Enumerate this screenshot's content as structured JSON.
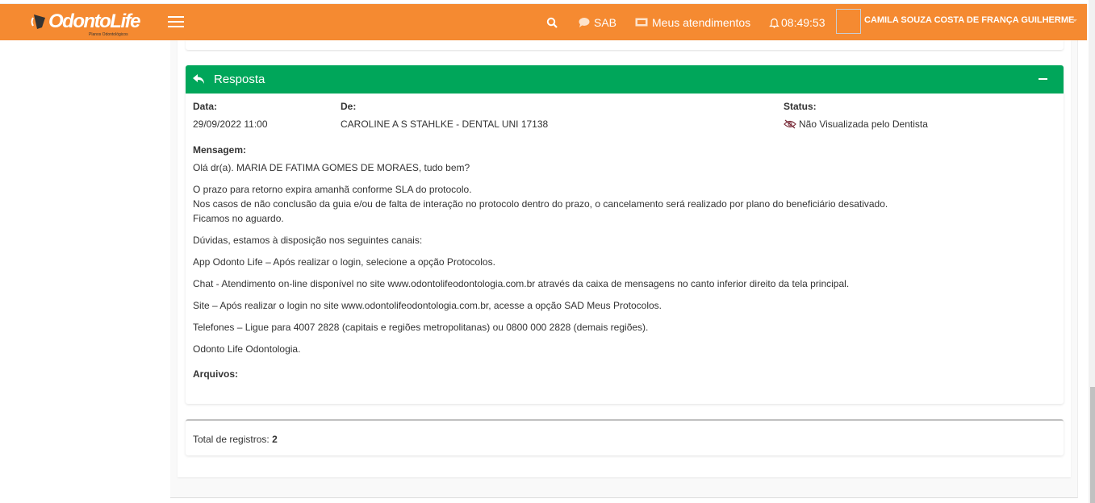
{
  "header": {
    "logo_text": "OdontoLife",
    "logo_sub": "Planos Odontológicos",
    "nav": {
      "sab": "SAB",
      "atendimentos": "Meus atendimentos",
      "clock": "08:49:53"
    },
    "user_name": "CAMILA SOUZA COSTA DE FRANÇA GUILHERME"
  },
  "card": {
    "title": "Resposta",
    "data_label": "Data:",
    "data_value": "29/09/2022 11:00",
    "de_label": "De:",
    "de_value": "CAROLINE A S STAHLKE - DENTAL UNI 17138",
    "status_label": "Status:",
    "status_value": "Não Visualizada pelo Dentista",
    "mensagem_label": "Mensagem:",
    "message": [
      "Olá dr(a). MARIA DE FATIMA GOMES DE MORAES, tudo bem?",
      "O prazo para retorno expira amanhã conforme SLA do protocolo.",
      "Nos casos de não conclusão da guia e/ou de falta de interação no protocolo dentro do prazo, o cancelamento será realizado por plano do beneficiário desativado.",
      "Ficamos no aguardo.",
      "Dúvidas, estamos à disposição nos seguintes canais:",
      "App Odonto Life – Após realizar o login, selecione a opção Protocolos.",
      "Chat - Atendimento on-line disponível no site www.odontolifeodontologia.com.br através da caixa de mensagens no canto inferior direito da tela principal.",
      "Site – Após realizar o login no site www.odontolifeodontologia.com.br, acesse a opção SAD Meus Protocolos.",
      "Telefones – Ligue para 4007 2828 (capitais e regiões metropolitanas) ou 0800 000 2828 (demais regiões).",
      "Odonto Life Odontologia."
    ],
    "arquivos_label": "Arquivos:"
  },
  "footer": {
    "total_label": "Total de registros:",
    "total_value": "2"
  },
  "colors": {
    "header": "#f58a31",
    "card_header": "#00a65a"
  }
}
